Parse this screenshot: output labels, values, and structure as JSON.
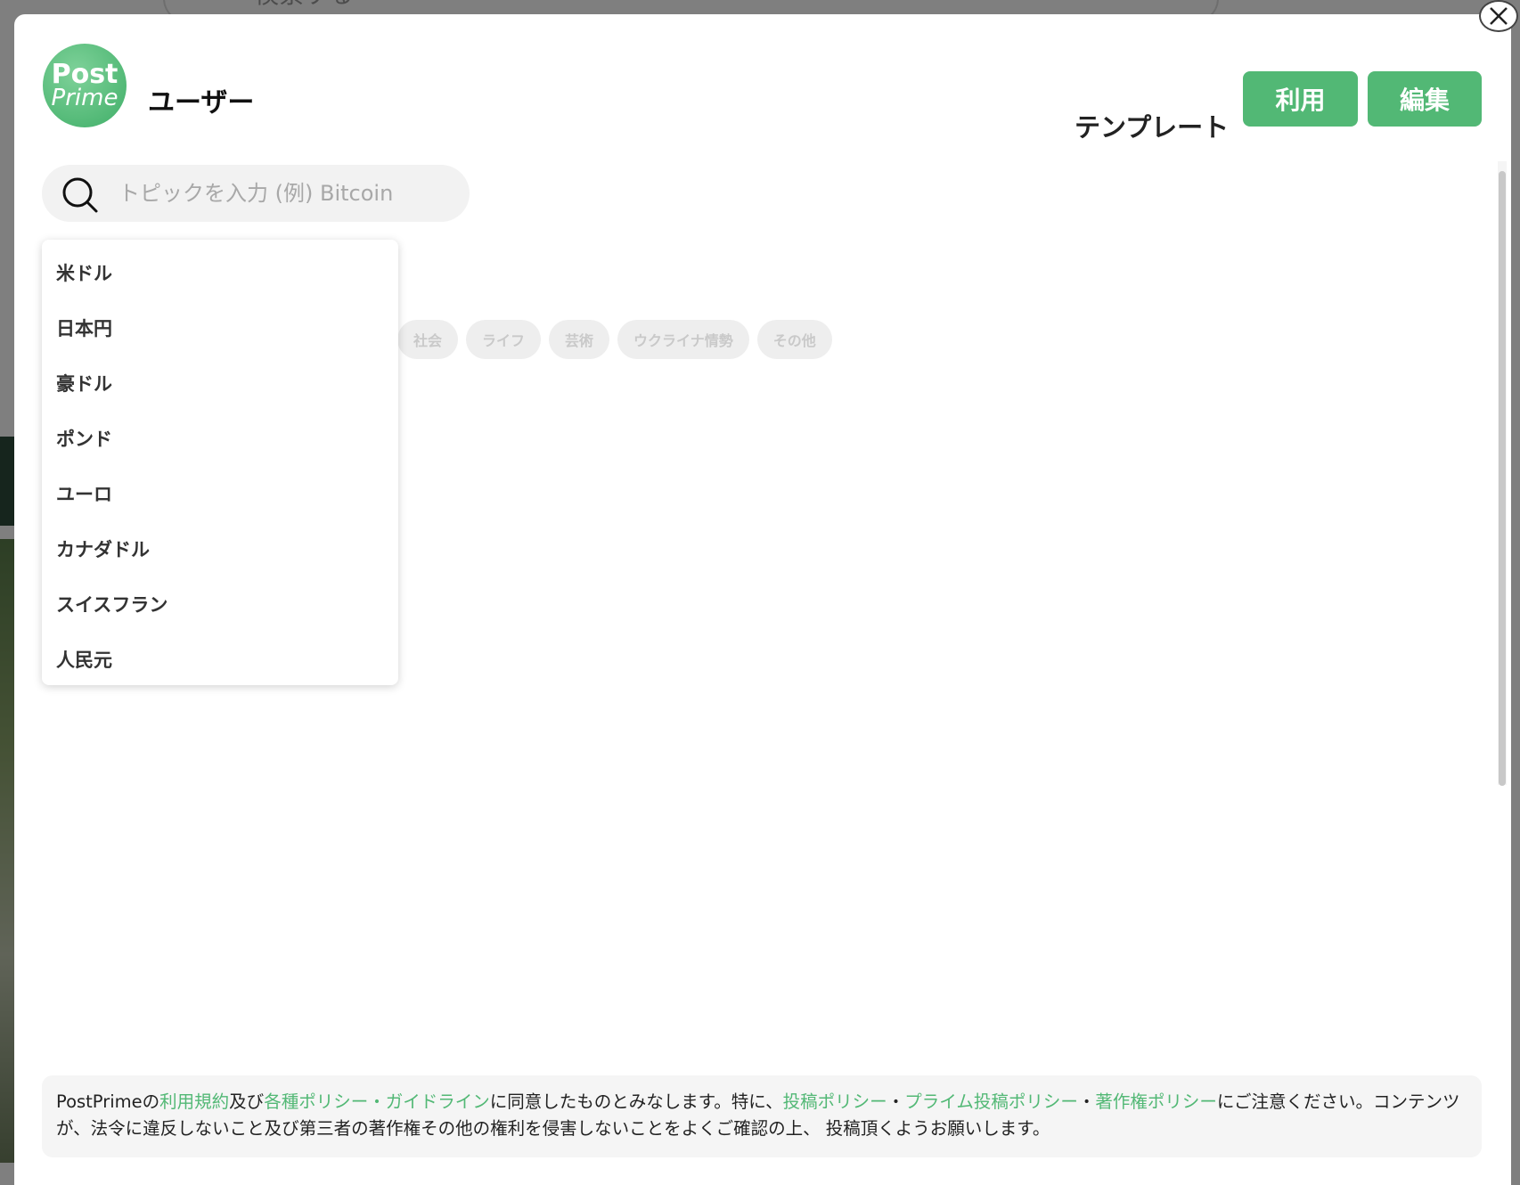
{
  "background": {
    "search_placeholder": "検索する"
  },
  "modal": {
    "logo": {
      "line1": "Post",
      "line2": "Prime"
    },
    "user_name": "ユーザー",
    "template_label": "テンプレート",
    "use_button": "利用",
    "edit_button": "編集",
    "search_placeholder": "トピックを入力 (例) Bitcoin",
    "dropdown_items": [
      "米ドル",
      "日本円",
      "豪ドル",
      "ポンド",
      "ユーロ",
      "カナダドル",
      "スイスフラン",
      "人民元"
    ],
    "tags": [
      "社会",
      "ライフ",
      "芸術",
      "ウクライナ情勢",
      "その他"
    ],
    "notice": {
      "t1": "PostPrimeの",
      "l1": "利用規約",
      "t2": "及び",
      "l2": "各種ポリシー・ガイドライン",
      "t3": "に同意したものとみなします。特に、",
      "l3": "投稿ポリシー",
      "t4": "・",
      "l4": "プライム投稿ポリシー",
      "t5": "・",
      "l5": "著作権ポリシー",
      "t6": "にご注意ください。コンテンツが、法令に違反しないこと及び第三者の著作権その他の権利を侵害しないことをよくご確認の上、 投稿頂くようお願いします。"
    }
  },
  "colors": {
    "accent": "#52b875",
    "overlay": "rgba(0,0,0,0.5)"
  },
  "icons": [
    "search-icon",
    "close-icon"
  ]
}
